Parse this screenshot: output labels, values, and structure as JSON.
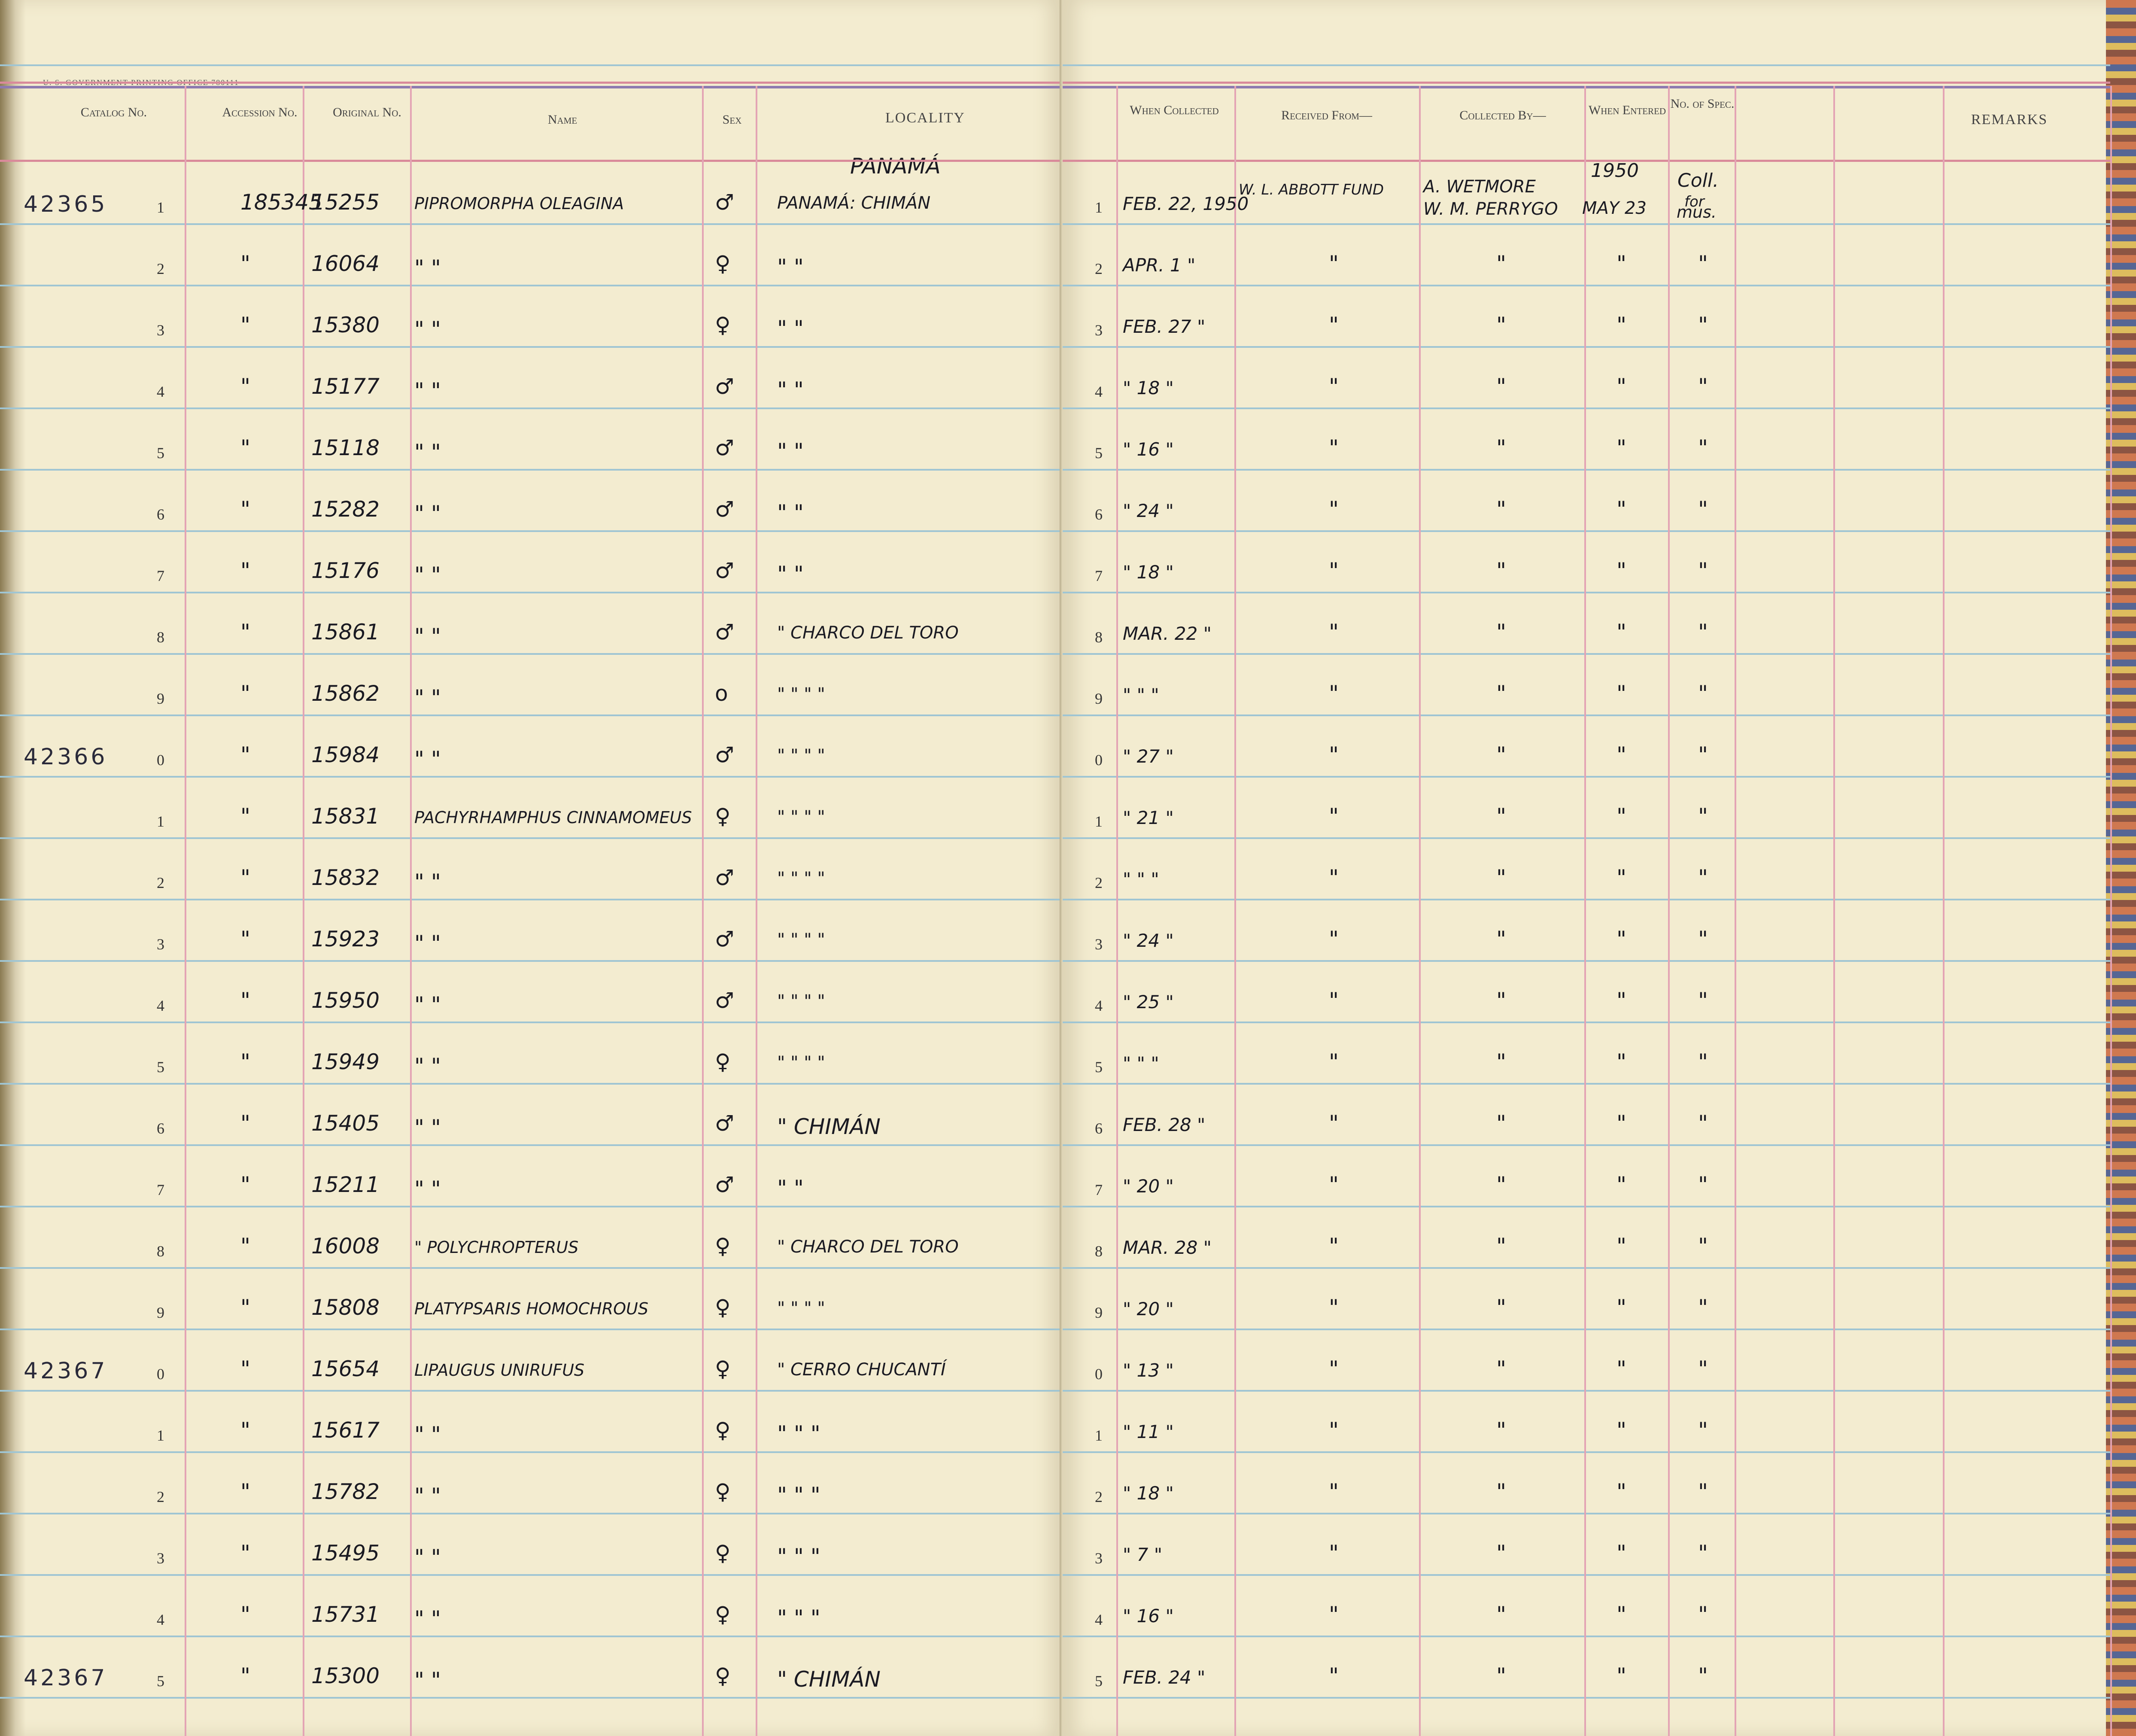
{
  "header": {
    "printer_line": "U. S. GOVERNMENT PRINTING OFFICE   780111",
    "left_columns": {
      "catalog": "Catalog No.",
      "accession": "Accession No.",
      "original": "Original No.",
      "name": "Name",
      "sex": "Sex",
      "locality": "LOCALITY"
    },
    "right_columns": {
      "when_collected": "When Collected",
      "received_from": "Received From—",
      "collected_by": "Collected By—",
      "when_entered": "When Entered",
      "no_of_spec": "No. of Spec.",
      "remarks": "REMARKS"
    }
  },
  "heading_notes": {
    "locality_region": "PANAMÁ",
    "entered_year": "1950",
    "spec_note": "Coll.",
    "spec_note_2": "for",
    "spec_note_3": "mus."
  },
  "ditto": "\"",
  "rows": [
    {
      "catalog": "42365",
      "digit": "1",
      "accession": "185345",
      "original": "15255",
      "name": "PIPROMORPHA OLEAGINA",
      "sex": "♂",
      "locality": "PANAMÁ: CHIMÁN",
      "rdigit": "1",
      "when": "FEB. 22, 1950",
      "received": "W. L. ABBOTT FUND",
      "collected": "A. WETMORE",
      "collected2": "W. M. PERRYGO",
      "entered": "MAY 23",
      "spec": "mus."
    },
    {
      "catalog": "",
      "digit": "2",
      "accession": "\"",
      "original": "16064",
      "name": "\"        \"",
      "sex": "♀",
      "locality": "\"     \"",
      "rdigit": "2",
      "when": "APR. 1 \"",
      "received": "\"",
      "collected": "\"",
      "collected2": "",
      "entered": "\"",
      "spec": "\""
    },
    {
      "catalog": "",
      "digit": "3",
      "accession": "\"",
      "original": "15380",
      "name": "\"        \"",
      "sex": "♀",
      "locality": "\"     \"",
      "rdigit": "3",
      "when": "FEB. 27 \"",
      "received": "\"",
      "collected": "\"",
      "collected2": "",
      "entered": "\"",
      "spec": "\""
    },
    {
      "catalog": "",
      "digit": "4",
      "accession": "\"",
      "original": "15177",
      "name": "\"        \"",
      "sex": "♂",
      "locality": "\"     \"",
      "rdigit": "4",
      "when": "\" 18 \"",
      "received": "\"",
      "collected": "\"",
      "collected2": "",
      "entered": "\"",
      "spec": "\""
    },
    {
      "catalog": "",
      "digit": "5",
      "accession": "\"",
      "original": "15118",
      "name": "\"        \"",
      "sex": "♂",
      "locality": "\"     \"",
      "rdigit": "5",
      "when": "\" 16 \"",
      "received": "\"",
      "collected": "\"",
      "collected2": "",
      "entered": "\"",
      "spec": "\""
    },
    {
      "catalog": "",
      "digit": "6",
      "accession": "\"",
      "original": "15282",
      "name": "\"        \"",
      "sex": "♂",
      "locality": "\"     \"",
      "rdigit": "6",
      "when": "\" 24 \"",
      "received": "\"",
      "collected": "\"",
      "collected2": "",
      "entered": "\"",
      "spec": "\""
    },
    {
      "catalog": "",
      "digit": "7",
      "accession": "\"",
      "original": "15176",
      "name": "\"        \"",
      "sex": "♂",
      "locality": "\"     \"",
      "rdigit": "7",
      "when": "\" 18 \"",
      "received": "\"",
      "collected": "\"",
      "collected2": "",
      "entered": "\"",
      "spec": "\""
    },
    {
      "catalog": "",
      "digit": "8",
      "accession": "\"",
      "original": "15861",
      "name": "\"        \"",
      "sex": "♂",
      "locality": "\"  CHARCO DEL TORO",
      "rdigit": "8",
      "when": "MAR. 22 \"",
      "received": "\"",
      "collected": "\"",
      "collected2": "",
      "entered": "\"",
      "spec": "\""
    },
    {
      "catalog": "",
      "digit": "9",
      "accession": "\"",
      "original": "15862",
      "name": "\"        \"",
      "sex": "o",
      "locality": "\"    \"    \"  \"",
      "rdigit": "9",
      "when": "\" \" \"",
      "received": "\"",
      "collected": "\"",
      "collected2": "",
      "entered": "\"",
      "spec": "\""
    },
    {
      "catalog": "42366",
      "digit": "0",
      "accession": "\"",
      "original": "15984",
      "name": "\"        \"",
      "sex": "♂",
      "locality": "\"    \"    \"  \"",
      "rdigit": "0",
      "when": "\" 27 \"",
      "received": "\"",
      "collected": "\"",
      "collected2": "",
      "entered": "\"",
      "spec": "\""
    },
    {
      "catalog": "",
      "digit": "1",
      "accession": "\"",
      "original": "15831",
      "name": "PACHYRHAMPHUS CINNAMOMEUS",
      "sex": "♀",
      "locality": "\"    \"    \"  \"",
      "rdigit": "1",
      "when": "\" 21 \"",
      "received": "\"",
      "collected": "\"",
      "collected2": "",
      "entered": "\"",
      "spec": "\""
    },
    {
      "catalog": "",
      "digit": "2",
      "accession": "\"",
      "original": "15832",
      "name": "\"        \"",
      "sex": "♂",
      "locality": "\"    \"    \"  \"",
      "rdigit": "2",
      "when": "\" \" \"",
      "received": "\"",
      "collected": "\"",
      "collected2": "",
      "entered": "\"",
      "spec": "\""
    },
    {
      "catalog": "",
      "digit": "3",
      "accession": "\"",
      "original": "15923",
      "name": "\"        \"",
      "sex": "♂",
      "locality": "\"    \"    \"  \"",
      "rdigit": "3",
      "when": "\" 24 \"",
      "received": "\"",
      "collected": "\"",
      "collected2": "",
      "entered": "\"",
      "spec": "\""
    },
    {
      "catalog": "",
      "digit": "4",
      "accession": "\"",
      "original": "15950",
      "name": "\"        \"",
      "sex": "♂",
      "locality": "\"    \"    \"  \"",
      "rdigit": "4",
      "when": "\" 25 \"",
      "received": "\"",
      "collected": "\"",
      "collected2": "",
      "entered": "\"",
      "spec": "\""
    },
    {
      "catalog": "",
      "digit": "5",
      "accession": "\"",
      "original": "15949",
      "name": "\"        \"",
      "sex": "♀",
      "locality": "\"    \"    \"  \"",
      "rdigit": "5",
      "when": "\" \" \"",
      "received": "\"",
      "collected": "\"",
      "collected2": "",
      "entered": "\"",
      "spec": "\""
    },
    {
      "catalog": "",
      "digit": "6",
      "accession": "\"",
      "original": "15405",
      "name": "\"        \"",
      "sex": "♂",
      "locality": "\"   CHIMÁN",
      "rdigit": "6",
      "when": "FEB. 28 \"",
      "received": "\"",
      "collected": "\"",
      "collected2": "",
      "entered": "\"",
      "spec": "\""
    },
    {
      "catalog": "",
      "digit": "7",
      "accession": "\"",
      "original": "15211",
      "name": "\"        \"",
      "sex": "♂",
      "locality": "\"     \"",
      "rdigit": "7",
      "when": "\" 20 \"",
      "received": "\"",
      "collected": "\"",
      "collected2": "",
      "entered": "\"",
      "spec": "\""
    },
    {
      "catalog": "",
      "digit": "8",
      "accession": "\"",
      "original": "16008",
      "name": "\"   POLYCHROPTERUS",
      "sex": "♀",
      "locality": "\"  CHARCO DEL TORO",
      "rdigit": "8",
      "when": "MAR. 28 \"",
      "received": "\"",
      "collected": "\"",
      "collected2": "",
      "entered": "\"",
      "spec": "\""
    },
    {
      "catalog": "",
      "digit": "9",
      "accession": "\"",
      "original": "15808",
      "name": "PLATYPSARIS HOMOCHROUS",
      "sex": "♀",
      "locality": "\"    \"    \"  \"",
      "rdigit": "9",
      "when": "\" 20 \"",
      "received": "\"",
      "collected": "\"",
      "collected2": "",
      "entered": "\"",
      "spec": "\""
    },
    {
      "catalog": "42367",
      "digit": "0",
      "accession": "\"",
      "original": "15654",
      "name": "LIPAUGUS UNIRUFUS",
      "sex": "♀",
      "locality": "\"  CERRO CHUCANTÍ",
      "rdigit": "0",
      "when": "\" 13 \"",
      "received": "\"",
      "collected": "\"",
      "collected2": "",
      "entered": "\"",
      "spec": "\""
    },
    {
      "catalog": "",
      "digit": "1",
      "accession": "\"",
      "original": "15617",
      "name": "\"        \"",
      "sex": "♀",
      "locality": "\"    \"    \"",
      "rdigit": "1",
      "when": "\" 11 \"",
      "received": "\"",
      "collected": "\"",
      "collected2": "",
      "entered": "\"",
      "spec": "\""
    },
    {
      "catalog": "",
      "digit": "2",
      "accession": "\"",
      "original": "15782",
      "name": "\"        \"",
      "sex": "♀",
      "locality": "\"    \"    \"",
      "rdigit": "2",
      "when": "\" 18 \"",
      "received": "\"",
      "collected": "\"",
      "collected2": "",
      "entered": "\"",
      "spec": "\""
    },
    {
      "catalog": "",
      "digit": "3",
      "accession": "\"",
      "original": "15495",
      "name": "\"        \"",
      "sex": "♀",
      "locality": "\"    \"    \"",
      "rdigit": "3",
      "when": "\" 7 \"",
      "received": "\"",
      "collected": "\"",
      "collected2": "",
      "entered": "\"",
      "spec": "\""
    },
    {
      "catalog": "",
      "digit": "4",
      "accession": "\"",
      "original": "15731",
      "name": "\"        \"",
      "sex": "♀",
      "locality": "\"    \"    \"",
      "rdigit": "4",
      "when": "\" 16 \"",
      "received": "\"",
      "collected": "\"",
      "collected2": "",
      "entered": "\"",
      "spec": "\""
    },
    {
      "catalog": "42367",
      "digit": "5",
      "accession": "\"",
      "original": "15300",
      "name": "\"        \"",
      "sex": "♀",
      "locality": "\"   CHIMÁN",
      "rdigit": "5",
      "when": "FEB. 24 \"",
      "received": "\"",
      "collected": "\"",
      "collected2": "",
      "entered": "\"",
      "spec": "\""
    }
  ]
}
